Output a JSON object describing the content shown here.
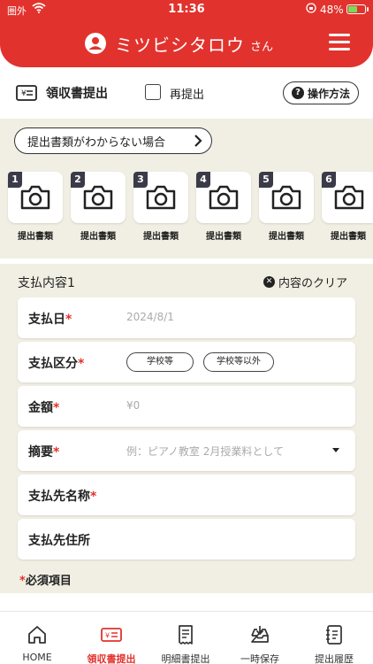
{
  "status_bar": {
    "carrier": "圏外",
    "time": "11:36",
    "battery": "48%",
    "battery_level": 0.48
  },
  "header": {
    "user_name": "ミツビシタロウ",
    "honorific": "さん"
  },
  "receipt": {
    "title": "領収書提出",
    "resubmit_label": "再提出",
    "howto_label": "操作方法"
  },
  "docs": {
    "unknown_button": "提出書類がわからない場合",
    "items": [
      {
        "num": "1",
        "label": "提出書類"
      },
      {
        "num": "2",
        "label": "提出書類"
      },
      {
        "num": "3",
        "label": "提出書類"
      },
      {
        "num": "4",
        "label": "提出書類"
      },
      {
        "num": "5",
        "label": "提出書類"
      },
      {
        "num": "6",
        "label": "提出書類"
      }
    ]
  },
  "payment": {
    "title": "支払内容1",
    "clear_label": "内容のクリア",
    "required_mark": "*",
    "pay_date": {
      "label": "支払日",
      "placeholder": "2024/8/1"
    },
    "category": {
      "label": "支払区分",
      "options": [
        "学校等",
        "学校等以外"
      ]
    },
    "amount": {
      "label": "金額",
      "placeholder": "¥0"
    },
    "summary": {
      "label": "摘要",
      "placeholder": "例：ピアノ教室 2月授業料として"
    },
    "payee_name": {
      "label": "支払先名称"
    },
    "payee_address": {
      "label": "支払先住所"
    },
    "required_note": "必須項目"
  },
  "nav": {
    "home": "HOME",
    "receipt": "領収書提出",
    "statement": "明細書提出",
    "temp_save": "一時保存",
    "history": "提出履歴"
  },
  "colors": {
    "brand_red": "#e2322d",
    "beige": "#f1efe3"
  }
}
